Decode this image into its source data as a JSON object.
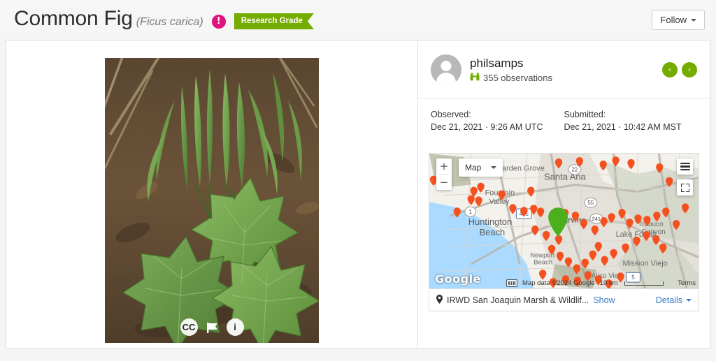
{
  "header": {
    "common_name": "Common Fig",
    "scientific_name": "(Ficus carica)",
    "alert_symbol": "!",
    "quality_grade": "Research Grade",
    "follow_label": "Follow"
  },
  "photo": {
    "license_icon": "CC",
    "flag_icon": "flag",
    "info_icon": "i"
  },
  "observer": {
    "username": "philsamps",
    "observations": "355 observations",
    "binoculars_icon": "binoculars-icon",
    "prev_label": "‹",
    "next_label": "›"
  },
  "dates": {
    "observed_label": "Observed:",
    "observed_value": "Dec 21, 2021 · 9:26 AM UTC",
    "submitted_label": "Submitted:",
    "submitted_value": "Dec 21, 2021 · 10:42 AM MST"
  },
  "map": {
    "zoom_in": "+",
    "zoom_out": "−",
    "map_type": "Map",
    "layers_icon": "layers-icon",
    "fullscreen_icon": "fullscreen-icon",
    "google_logo": "Google",
    "keyboard_icon": "keyboard-shortcuts-icon",
    "attribution": "Map data ©2024 Google",
    "scale": "10 km",
    "terms": "Terms",
    "labels": [
      "Garden Grove",
      "Santa Ana",
      "Fountain Valley",
      "Huntington Beach",
      "Newport Beach",
      "Irvine",
      "Lake Forest",
      "Trabuco Canyon",
      "Mission Viejo",
      "Aliso Viejo"
    ],
    "shields": [
      "22",
      "55",
      "405",
      "1",
      "241",
      "5"
    ],
    "marker_color": "#f4511e",
    "current_marker_color": "#4caf1d"
  },
  "location": {
    "pin_icon": "map-pin-icon",
    "place_name": "IRWD San Joaquin Marsh & Wildlif...",
    "show_label": "Show",
    "details_label": "Details"
  },
  "colors": {
    "accent_green": "#74ac00",
    "alert_pink": "#e0127f",
    "link_blue": "#3b7cc4"
  }
}
